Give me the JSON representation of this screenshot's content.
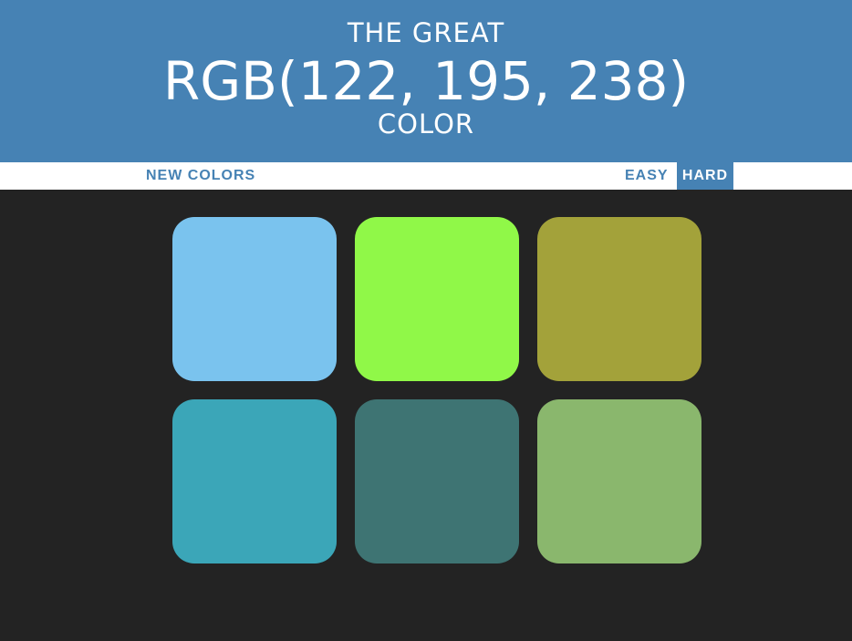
{
  "header": {
    "line1": "THE GREAT",
    "target_color": "RGB(122, 195, 238)",
    "line3": "COLOR",
    "background": "#4682b4"
  },
  "stripe": {
    "new_colors_label": "NEW COLORS",
    "easy_label": "EASY",
    "hard_label": "HARD",
    "selected_mode": "HARD"
  },
  "squares": [
    {
      "color": "#7ac3ee"
    },
    {
      "color": "#90f848"
    },
    {
      "color": "#a3a23a"
    },
    {
      "color": "#3ba6b8"
    },
    {
      "color": "#3e7473"
    },
    {
      "color": "#8ab76d"
    }
  ],
  "page_background": "#232323"
}
